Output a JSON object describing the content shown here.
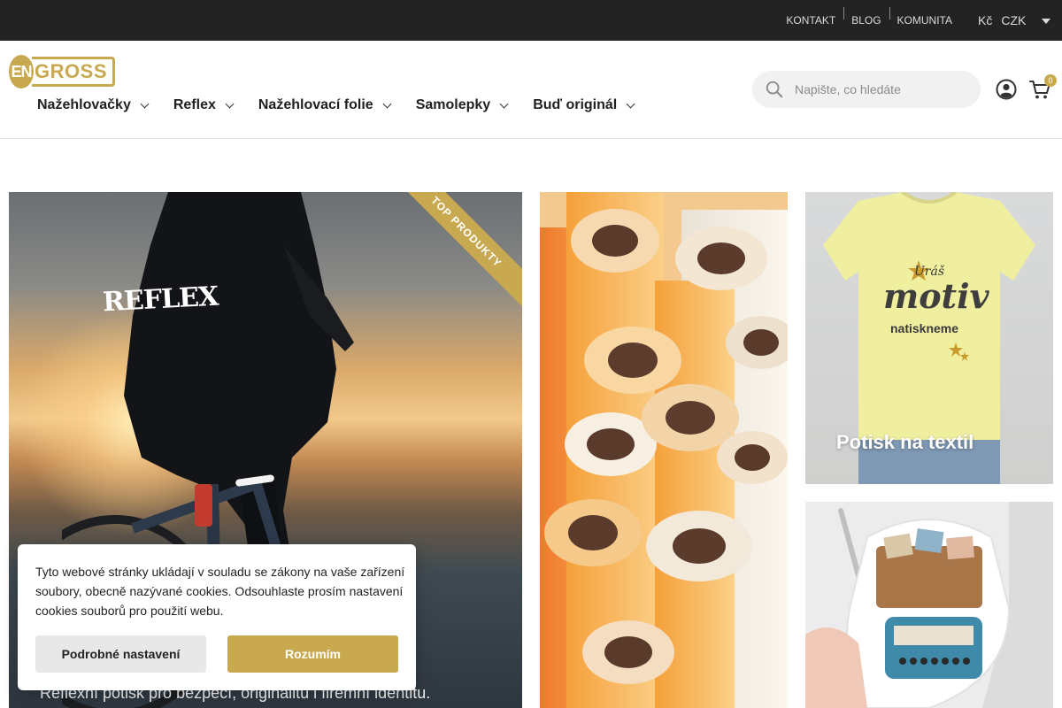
{
  "topbar": {
    "links": [
      "KONTAKT",
      "BLOG",
      "KOMUNITA"
    ],
    "currency_symbol": "Kč",
    "currency_code": "CZK"
  },
  "header": {
    "logo": {
      "left": "EN",
      "right": "GROSS"
    },
    "nav": [
      {
        "label": "Nažehlovačky"
      },
      {
        "label": "Reflex"
      },
      {
        "label": "Nažehlovací folie"
      },
      {
        "label": "Samolepky"
      },
      {
        "label": "Buď originál"
      }
    ],
    "search": {
      "placeholder": "Napište, co hledáte"
    },
    "cart": {
      "count": "0"
    }
  },
  "tiles": {
    "reflex": {
      "logo_text": "REFLEX",
      "ribbon": "TOP PRODUKTY",
      "description": "Reflexní potisk pro bezpečí, originalitu i firemní identitu."
    },
    "textil": {
      "label": "Potisk na textil",
      "shirt_small": "Uráš",
      "shirt_big": "motiv",
      "shirt_mid": "natiskneme"
    }
  },
  "cookie": {
    "text": "Tyto webové stránky ukládají v souladu se zákony na vaše zařízení soubory, obecně nazývané cookies. Odsouhlaste prosím nastavení cookies souborů pro použití webu.",
    "settings_button": "Podrobné nastavení",
    "accept_button": "Rozumím"
  },
  "colors": {
    "accent": "#c9a94f",
    "topbar": "#232323"
  },
  "icons": [
    "search-icon",
    "user-icon",
    "cart-icon",
    "chevron-down-icon",
    "caret-down-icon"
  ]
}
